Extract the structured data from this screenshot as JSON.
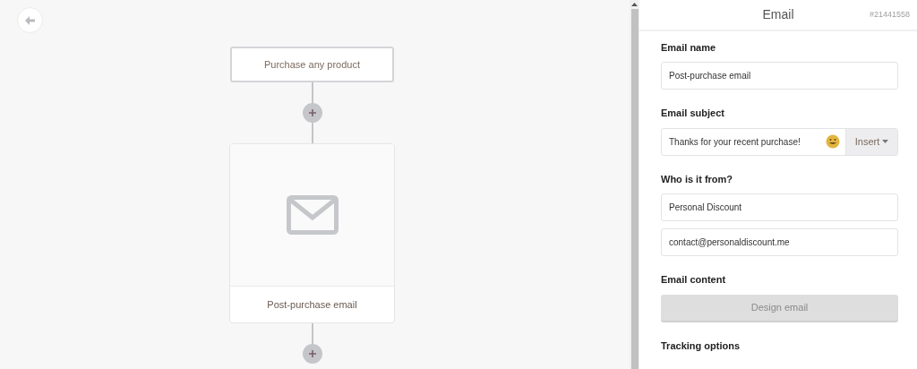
{
  "canvas": {
    "nodes": [
      {
        "kind": "trigger",
        "label": "Purchase any product"
      },
      {
        "kind": "email",
        "label": "Post-purchase email"
      }
    ]
  },
  "panel": {
    "title": "Email",
    "id": "#21441558",
    "sections": [
      {
        "label": "Email name",
        "fields": [
          {
            "value": "Post-purchase email"
          }
        ]
      },
      {
        "label": "Email subject",
        "fields": [
          {
            "value": "Thanks for your recent purchase!",
            "emoji": true,
            "insert": "Insert"
          }
        ]
      },
      {
        "label": "Who is it from?",
        "fields": [
          {
            "value": "Personal Discount"
          },
          {
            "value": "contact@personaldiscount.me"
          }
        ]
      },
      {
        "label": "Email content",
        "button": "Design email"
      },
      {
        "label": "Tracking options"
      }
    ]
  }
}
